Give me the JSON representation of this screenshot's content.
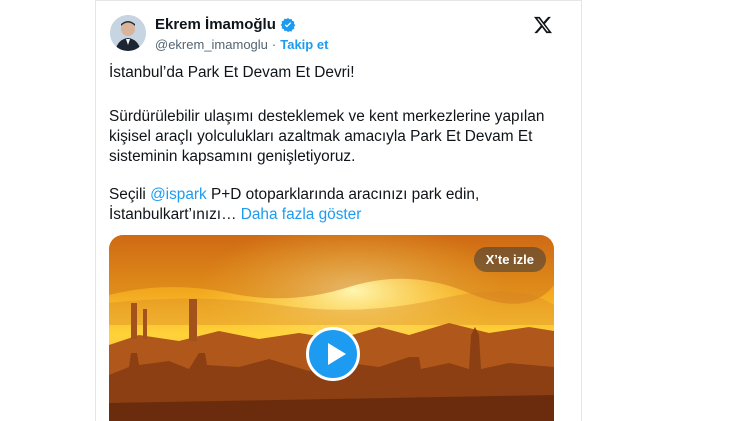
{
  "tweet": {
    "author_name": "Ekrem İmamoğlu",
    "handle": "@ekrem_imamoglu",
    "separator": "·",
    "follow_label": "Takip et",
    "line1": "İstanbul’da Park Et Devam Et Devri!",
    "para2": "Sürdürülebilir ulaşımı desteklemek ve kent merkezlerine yapılan kişisel araçlı yolculukları azaltmak amacıyla Park Et Devam Et sisteminin kapsamını genişletiyoruz.",
    "para3_prefix": "Seçili ",
    "mention": "@ispark",
    "para3_rest": " P+D otoparklarında aracınızı park edin,",
    "para3_line2": "İstanbulkart’ınızı… ",
    "show_more": "Daha fazla göster"
  },
  "media": {
    "watch_on_x_label": "X’te izle"
  },
  "colors": {
    "accent": "#1d9bf0",
    "text": "#0f1419",
    "muted": "#536471"
  }
}
